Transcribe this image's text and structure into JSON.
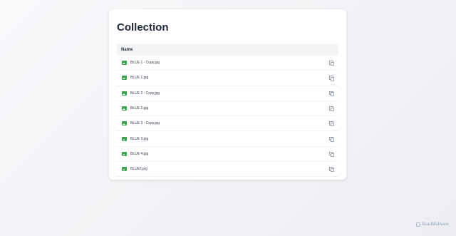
{
  "page": {
    "title": "Collection"
  },
  "table": {
    "header": "Name",
    "rows": [
      {
        "name": "BLUE 1 - Copy.jpg",
        "icon": "image-file-icon"
      },
      {
        "name": "BLUE 1.jpg",
        "icon": "image-file-icon"
      },
      {
        "name": "BLUE 2 - Copy.jpg",
        "icon": "image-file-icon"
      },
      {
        "name": "BLUE 2.jpg",
        "icon": "image-file-icon"
      },
      {
        "name": "BLUE 3 - Copy.jpg",
        "icon": "image-file-icon"
      },
      {
        "name": "BLUE 3.jpg",
        "icon": "image-file-icon"
      },
      {
        "name": "BLUE 4.jpg",
        "icon": "image-file-icon"
      },
      {
        "name": "BLUE5.jpg",
        "icon": "image-file-icon"
      }
    ]
  },
  "footer": {
    "brand": "ScanMalware"
  },
  "colors": {
    "file_icon": "#3fa34d",
    "title": "#1f2937",
    "brand": "#aab7c8"
  }
}
